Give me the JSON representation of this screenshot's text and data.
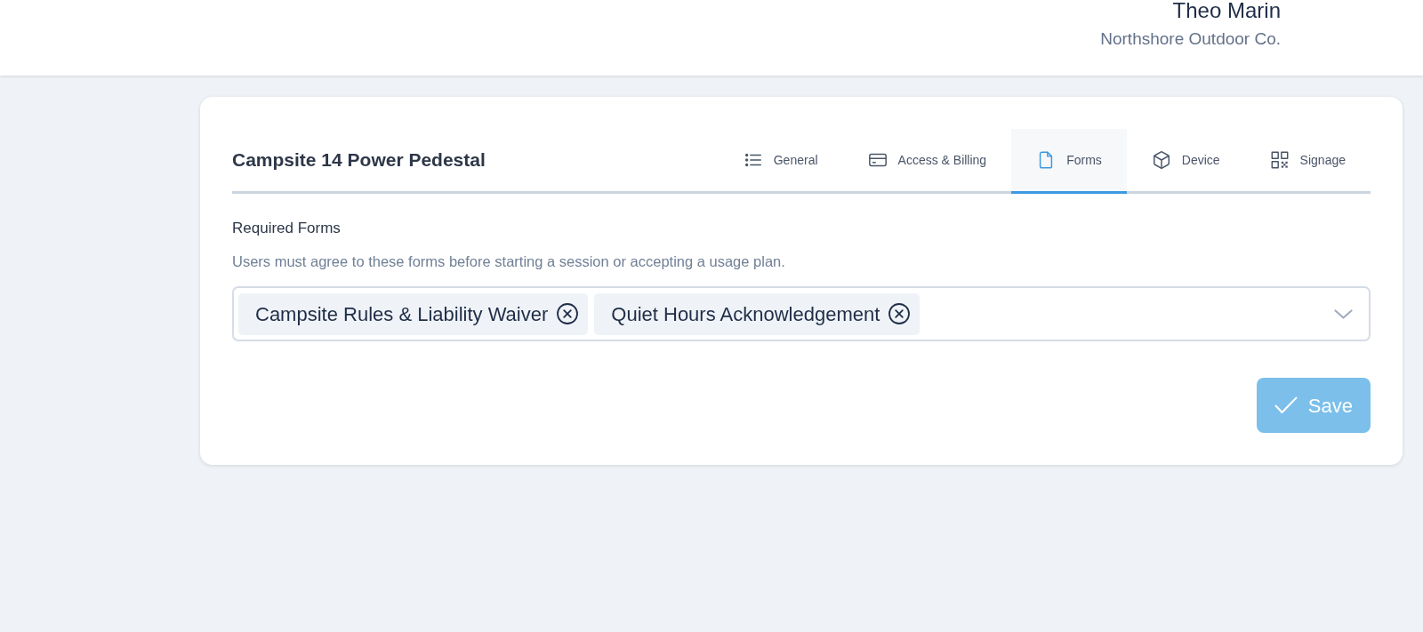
{
  "header": {
    "user_name": "Theo Marin",
    "organization": "Northshore Outdoor Co."
  },
  "card": {
    "title": "Campsite 14 Power Pedestal",
    "tabs": [
      {
        "label": "General",
        "selected": false
      },
      {
        "label": "Access & Billing",
        "selected": false
      },
      {
        "label": "Forms",
        "selected": true
      },
      {
        "label": "Device",
        "selected": false
      },
      {
        "label": "Signage",
        "selected": false
      }
    ],
    "required_forms": {
      "label": "Required Forms",
      "description": "Users must agree to these forms before starting a session or accepting a usage plan.",
      "selected_items": [
        {
          "label": "Campsite Rules & Liability Waiver"
        },
        {
          "label": "Quiet Hours Acknowledgement"
        }
      ]
    },
    "save_button": {
      "label": "Save",
      "disabled": true
    }
  }
}
